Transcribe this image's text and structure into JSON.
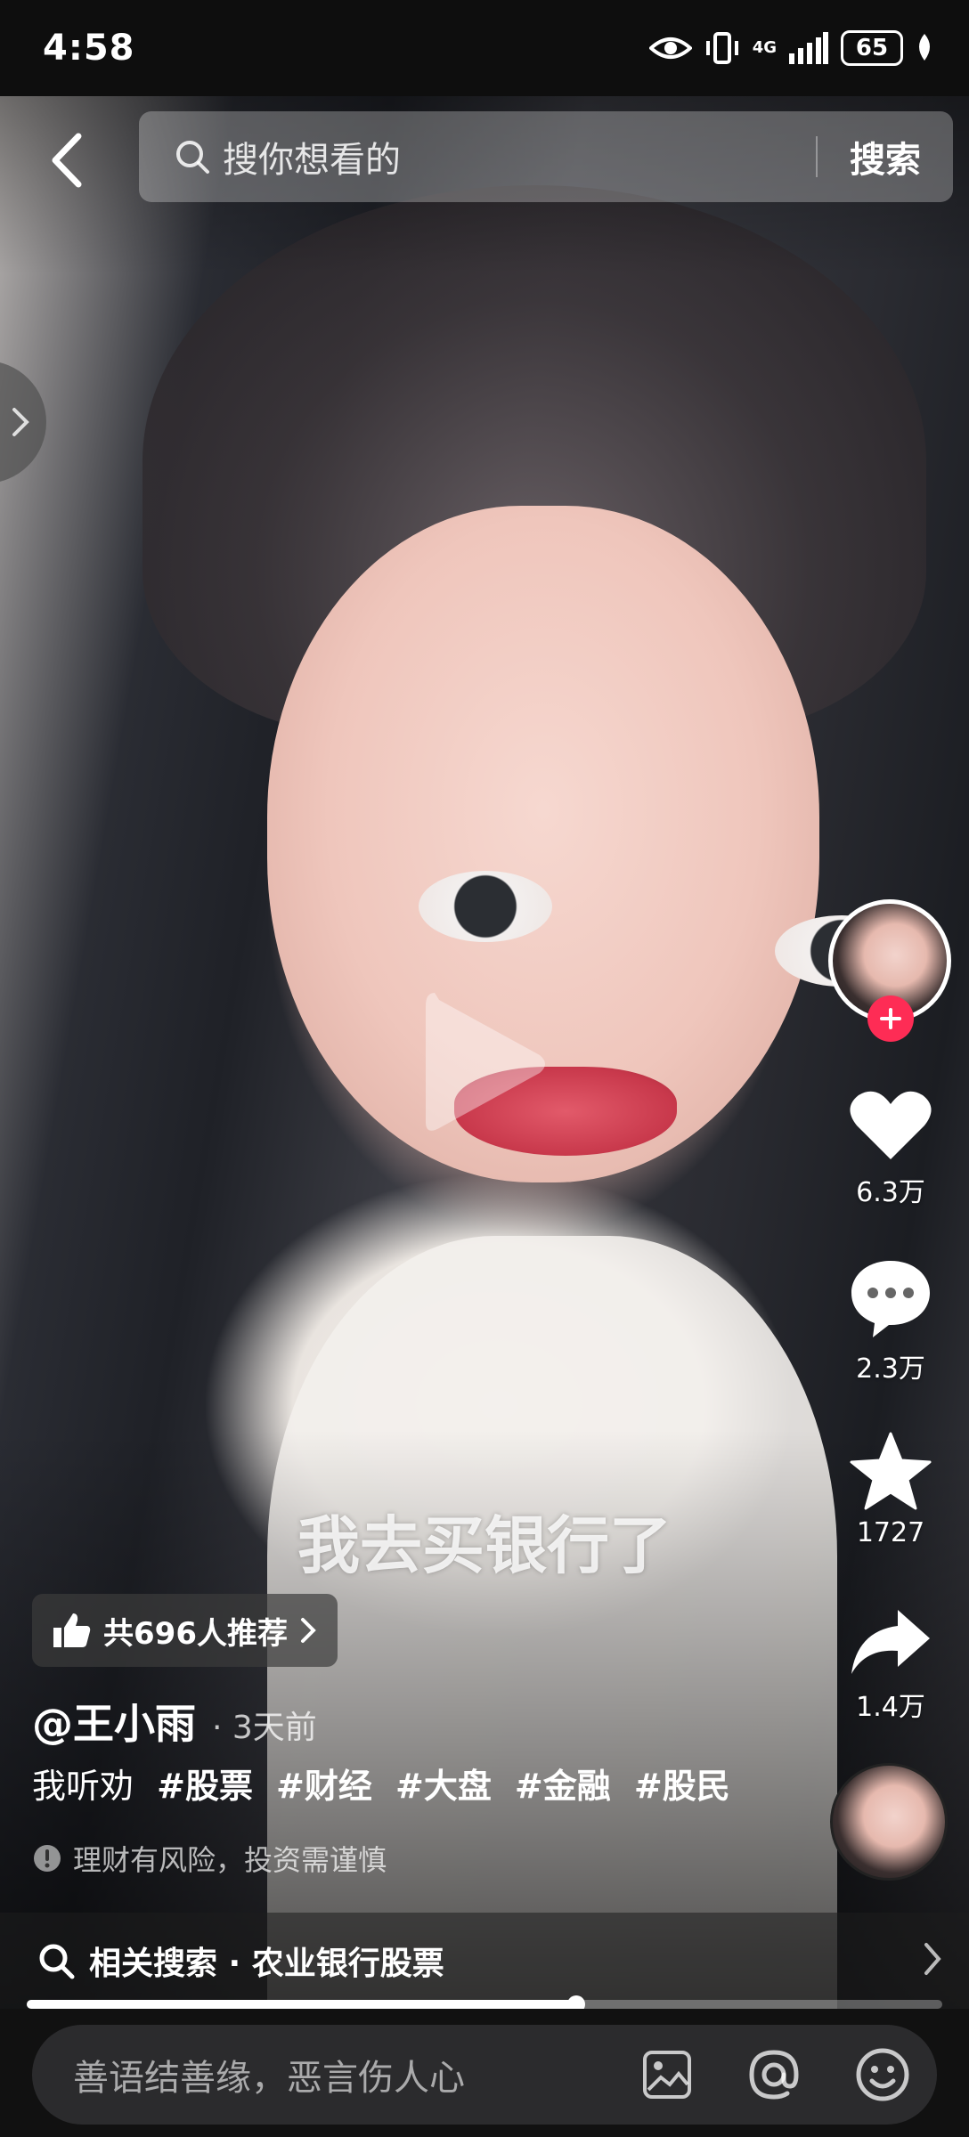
{
  "status_bar": {
    "time": "4:58",
    "network": "4G",
    "battery": "65"
  },
  "top_nav": {
    "search_placeholder": "搜你想看的",
    "search_button": "搜索"
  },
  "video": {
    "subtitle": "我去买银行了",
    "colors": {
      "accent": "#fe2c55"
    }
  },
  "rail": {
    "likes": "6.3万",
    "comments": "2.3万",
    "favorites": "1727",
    "shares": "1.4万"
  },
  "info": {
    "recommend": "共696人推荐",
    "author": "@王小雨",
    "post_time": "· 3天前",
    "caption_text": "我听劝",
    "tags": [
      "#股票",
      "#财经",
      "#大盘",
      "#金融",
      "#股民"
    ],
    "risk_notice": "理财有风险，投资需谨慎",
    "related_search": "相关搜索 · 农业银行股票",
    "progress_fraction": 0.6
  },
  "comment_bar": {
    "placeholder": "善语结善缘，恶言伤人心"
  },
  "icons": [
    "back-icon",
    "search-icon",
    "eye-icon",
    "vibrate-icon",
    "signal-icon",
    "leaf-icon",
    "chevron-right-icon",
    "play-icon",
    "plus-icon",
    "heart-icon",
    "comment-icon",
    "star-icon",
    "share-icon",
    "thumbs-up-icon",
    "warning-icon",
    "image-icon",
    "at-icon",
    "emoji-icon"
  ]
}
